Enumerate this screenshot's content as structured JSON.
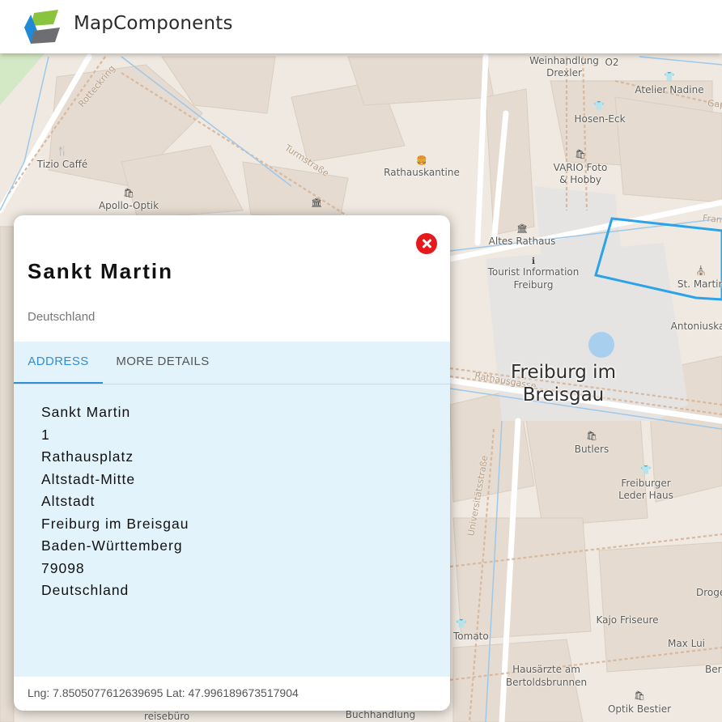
{
  "header": {
    "brand": "MapComponents",
    "logo_colors": {
      "green": "#8ac43f",
      "blue": "#1f8ad6",
      "gray": "#6d6e71"
    }
  },
  "map": {
    "city_label_line1": "Freiburg im",
    "city_label_line2": "Breisgau",
    "selected_outline_color": "#2aa3e8",
    "poi": [
      {
        "label": "Weinhandlung",
        "icon": ""
      },
      {
        "label": "O2",
        "icon": ""
      },
      {
        "label": "Drexler",
        "icon": ""
      },
      {
        "label": "Atelier Nadine",
        "icon": "clothing-icon"
      },
      {
        "label": "Hosen-Eck",
        "icon": "clothing-icon"
      },
      {
        "label": "Tizio Caffé",
        "icon": "restaurant-icon"
      },
      {
        "label": "Rathauskantine",
        "icon": "fast-food-icon"
      },
      {
        "label": "VARIO Foto",
        "icon": "shop-icon"
      },
      {
        "label": "& Hobby",
        "icon": ""
      },
      {
        "label": "Apollo-Optik",
        "icon": "shop-icon"
      },
      {
        "label": "Altes Rathaus",
        "icon": "townhall-icon"
      },
      {
        "label": "Tourist Information",
        "icon": "info-icon"
      },
      {
        "label": "Freiburg",
        "icon": ""
      },
      {
        "label": "St. Martin",
        "icon": "church-icon"
      },
      {
        "label": "Antoniuska",
        "icon": ""
      },
      {
        "label": "Butlers",
        "icon": "shop-icon"
      },
      {
        "label": "Freiburger",
        "icon": "clothing-icon"
      },
      {
        "label": "Leder Haus",
        "icon": ""
      },
      {
        "label": "Droge",
        "icon": ""
      },
      {
        "label": "Tomato",
        "icon": "clothing-icon"
      },
      {
        "label": "Kajo Friseure",
        "icon": ""
      },
      {
        "label": "Max Lui",
        "icon": ""
      },
      {
        "label": "Hausärzte am",
        "icon": ""
      },
      {
        "label": "Bertoldsbrunnen",
        "icon": ""
      },
      {
        "label": "Optik Bestier",
        "icon": "shop-icon"
      },
      {
        "label": "Ber",
        "icon": ""
      },
      {
        "label": "reisebüro",
        "icon": ""
      },
      {
        "label": "Buchhandlung",
        "icon": ""
      }
    ],
    "streets": {
      "rotteck": "Rotteckring",
      "turm": "Turmstraße",
      "rathausgasse": "Rathausgasse",
      "universitaet": "Universitätsstraße",
      "fran": "Fran",
      "gap": "Gap"
    }
  },
  "popup": {
    "title": "Sankt Martin",
    "subtitle": "Deutschland",
    "tabs": [
      {
        "label": "ADDRESS",
        "active": true
      },
      {
        "label": "MORE DETAILS",
        "active": false
      }
    ],
    "address_lines": [
      "Sankt Martin",
      "1",
      "Rathausplatz",
      "Altstadt-Mitte",
      "Altstadt",
      "Freiburg im Breisgau",
      "Baden-Württemberg",
      "79098",
      "Deutschland"
    ],
    "coordinates": "Lng: 7.8505077612639695 Lat: 47.996189673517904",
    "colors": {
      "tab_active": "#2e8fd4",
      "tab_bg": "#e3f3fc",
      "close": "#e8191c"
    }
  }
}
